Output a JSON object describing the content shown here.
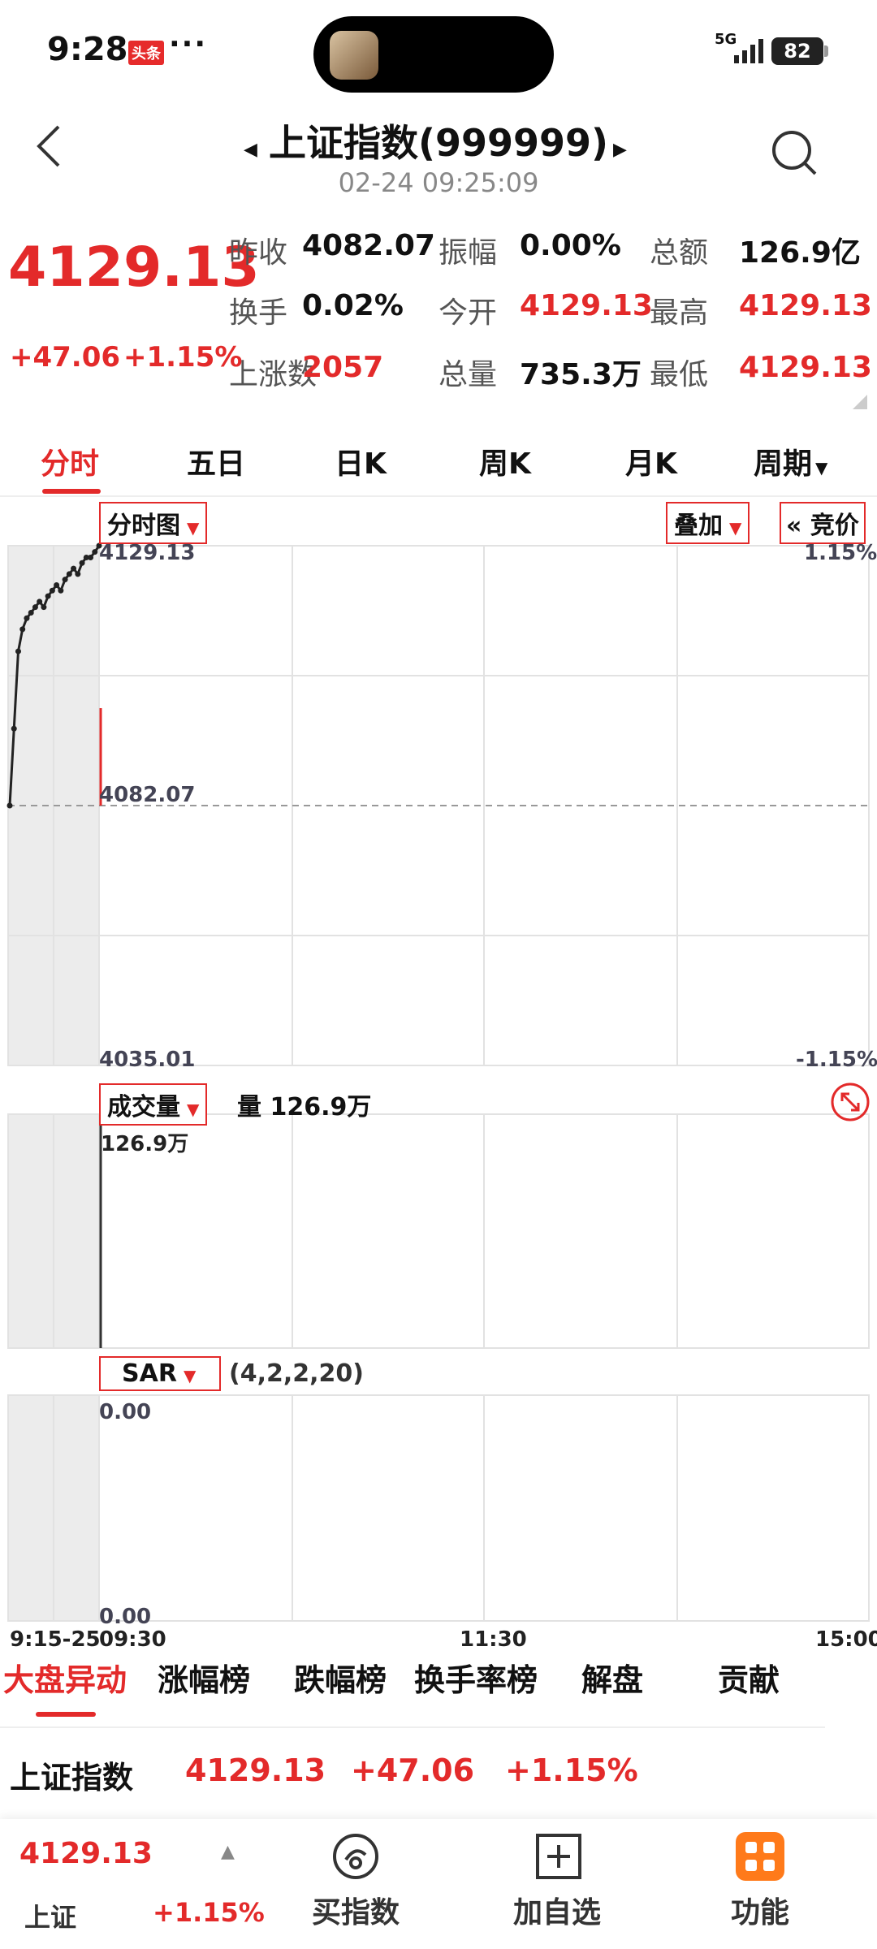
{
  "status": {
    "time": "9:28",
    "badge": "头条",
    "more": "···",
    "network": "5G",
    "battery": "82"
  },
  "header": {
    "title": "上证指数(999999)",
    "datetime": "02-24 09:25:09"
  },
  "quote": {
    "price": "4129.13",
    "change": "+47.06",
    "change_pct": "+1.15%",
    "rows": [
      [
        {
          "label": "昨收",
          "value": "4082.07",
          "color": "#111"
        },
        {
          "label": "振幅",
          "value": "0.00%",
          "color": "#111"
        },
        {
          "label": "总额",
          "value": "126.9亿",
          "color": "#111"
        }
      ],
      [
        {
          "label": "换手",
          "value": "0.02%",
          "color": "#111"
        },
        {
          "label": "今开",
          "value": "4129.13",
          "color": "#e32a2a"
        },
        {
          "label": "最高",
          "value": "4129.13",
          "color": "#e32a2a"
        }
      ],
      [
        {
          "label": "上涨数",
          "value": "2057",
          "color": "#e32a2a"
        },
        {
          "label": "总量",
          "value": "735.3万",
          "color": "#111"
        },
        {
          "label": "最低",
          "value": "4129.13",
          "color": "#e32a2a"
        }
      ]
    ]
  },
  "tabs": [
    "分时",
    "五日",
    "日K",
    "周K",
    "月K",
    "周期"
  ],
  "chart": {
    "type_dropdown": "分时图",
    "overlay_dropdown": "叠加",
    "bid_button": "« 竞价",
    "price_high": "4129.13",
    "price_mid": "4082.07",
    "price_low": "4035.01",
    "pct_high": "1.15%",
    "pct_low": "-1.15%",
    "volume_dropdown": "成交量",
    "volume_label": "量 126.9万",
    "volume_max": "126.9万",
    "sar_dropdown": "SAR",
    "sar_params": "(4,2,2,20)",
    "sar_high": "0.00",
    "sar_low": "0.00",
    "time_labels": [
      "9:15-25",
      "09:30",
      "11:30",
      "15:00"
    ]
  },
  "chart_data": {
    "type": "line",
    "title": "",
    "xlabel": "",
    "ylabel": "",
    "ylim": [
      4035.01,
      4129.13
    ],
    "preauction_series": {
      "name": "",
      "values": [
        4082.07,
        4096,
        4110,
        4114,
        4116,
        4117,
        4118,
        4119,
        4118,
        4120,
        4121,
        4122,
        4121,
        4123,
        4124,
        4125,
        4124,
        4126,
        4127,
        4127,
        4128,
        4129.13
      ]
    },
    "volume": {
      "value_wan": 126.9
    }
  },
  "bottom_tabs": [
    "大盘异动",
    "涨幅榜",
    "跌幅榜",
    "换手率榜",
    "解盘",
    "贡献"
  ],
  "index_row": {
    "name": "上证指数",
    "price": "4129.13",
    "change": "+47.06",
    "change_pct": "+1.15%"
  },
  "footer": {
    "price": "4129.13",
    "name": "上证",
    "pct": "+1.15%",
    "buy_label": "买指数",
    "add_label": "加自选",
    "func_label": "功能"
  }
}
